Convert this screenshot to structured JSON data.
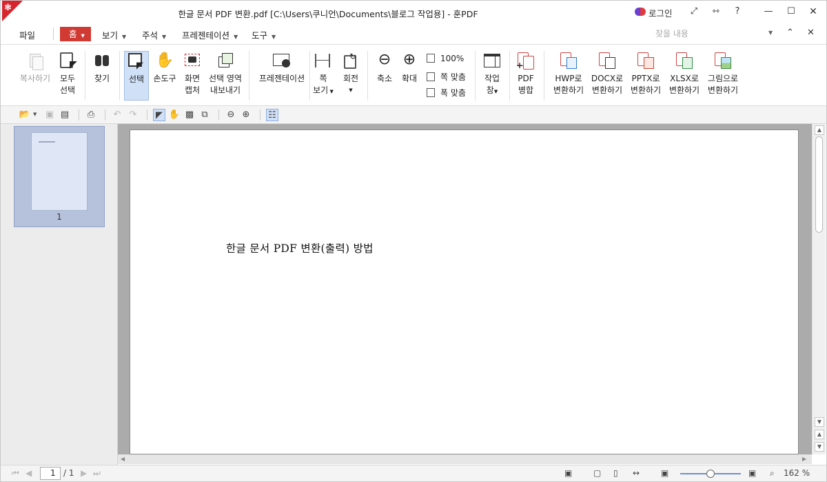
{
  "window": {
    "title": "한글 문서 PDF 변환.pdf [C:\\Users\\쿠니언\\Documents\\블로그 작업용] - 훈PDF",
    "login_label": "로그인",
    "controls": [
      "minimize-window",
      "maximize-window",
      "close-window"
    ]
  },
  "menubar": {
    "file": "파일",
    "home": "홈",
    "view": "보기",
    "annotate": "주석",
    "presentation": "프레젠테이션",
    "tools": "도구",
    "search_placeholder": "찾을 내용"
  },
  "ribbon": {
    "copy": "복사하기",
    "select_all_1": "모두",
    "select_all_2": "선택",
    "find": "찾기",
    "select": "선택",
    "hand": "손도구",
    "capture_1": "화면",
    "capture_2": "캡처",
    "export_1": "선택 영역",
    "export_2": "내보내기",
    "presentation": "프레젠테이션",
    "width_view_1": "쪽",
    "width_view_2": "보기",
    "rotate": "회전",
    "zoom_out": "축소",
    "zoom_in": "확대",
    "zoom_100": "100%",
    "fit_page": "쪽 맞춤",
    "fit_width": "폭 맞춤",
    "window_1": "작업",
    "window_2": "창",
    "merge_1": "PDF",
    "merge_2": "병합",
    "hwp_1": "HWP로",
    "hwp_2": "변환하기",
    "docx_1": "DOCX로",
    "docx_2": "변환하기",
    "pptx_1": "PPTX로",
    "pptx_2": "변환하기",
    "xlsx_1": "XLSX로",
    "xlsx_2": "변환하기",
    "image_1": "그림으로",
    "image_2": "변환하기"
  },
  "sidebar": {
    "thumbnail_page_number": "1"
  },
  "document": {
    "text": "한글  문서  PDF  변환(출력)  방법"
  },
  "status": {
    "current_page": "1",
    "total_pages": "/ 1",
    "zoom": "162 %",
    "zoom_level_fraction": 0.5
  },
  "colors": {
    "accent": "#d03a32",
    "selection": "#cfe0f7"
  }
}
